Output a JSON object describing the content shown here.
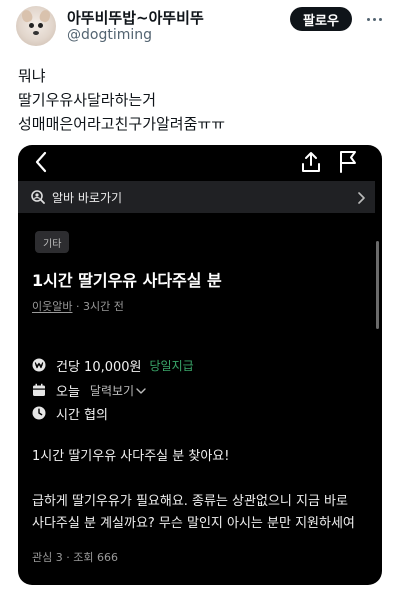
{
  "tweet": {
    "display_name": "아뚜비뚜밥~아뚜비뚜",
    "handle": "@dogtiming",
    "follow_label": "팔로우",
    "avatar_icon": "dog-avatar",
    "more_icon": "more-dots-icon",
    "lines": [
      "뭐냐",
      "딸기우유사달라하는거",
      "성매매은어라고친구가알려줌ㅠㅠ"
    ]
  },
  "app": {
    "nav_icons": [
      "back-chevron-icon",
      "share-icon",
      "flag-icon"
    ],
    "shortcut_label": "알바 바로가기",
    "category": "기타",
    "post_title": "1시간 딸기우유 사다주실 분",
    "poster": "이웃알바",
    "time_ago": "· 3시간 전",
    "pay": "건당 10,000원",
    "pay_note": "당일지급",
    "date_label": "오늘",
    "calendar_link": "달력보기",
    "time_label": "시간 협의",
    "body_lines": [
      "1시간 딸기우유 사다주실 분 찾아요!",
      "급하게 딸기우유가 필요해요. 종류는 상관없으니 지금 바로",
      "사다주실 분 계실까요? 무슨 말인지 아시는 분만 지원하세여"
    ],
    "stats": "관심 3 · 조회 666",
    "colors": {
      "background": "#000000",
      "shortcut_bar": "#202124",
      "accent_green": "#3aa66a",
      "muted": "#9a9a9a"
    }
  }
}
